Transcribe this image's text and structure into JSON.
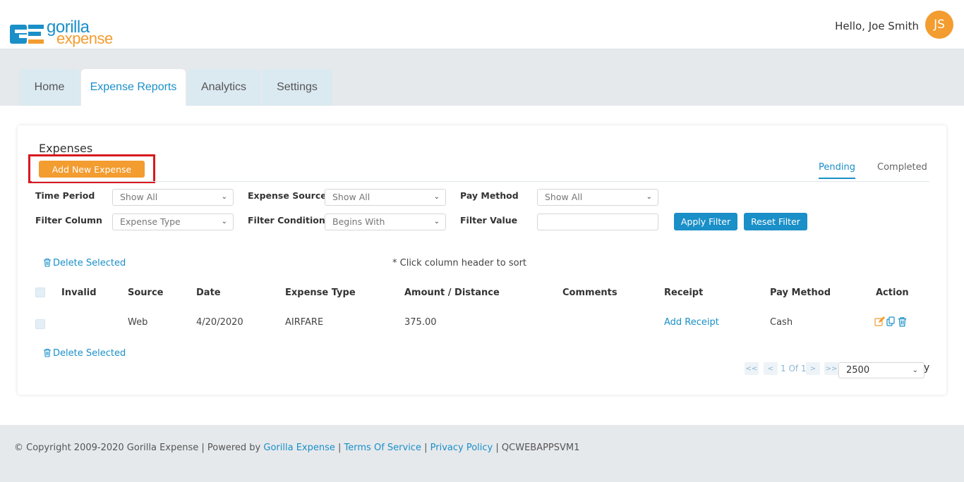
{
  "header": {
    "logo_word1": "gorilla",
    "logo_word2": "expense",
    "greeting": "Hello, Joe Smith",
    "avatar_initials": "JS"
  },
  "nav_tabs": [
    {
      "label": "Home",
      "active": false
    },
    {
      "label": "Expense Reports",
      "active": true
    },
    {
      "label": "Analytics",
      "active": false
    },
    {
      "label": "Settings",
      "active": false
    }
  ],
  "expenses": {
    "title": "Expenses",
    "add_button": "Add New Expense",
    "status_tabs": {
      "pending": "Pending",
      "completed": "Completed"
    }
  },
  "filters": {
    "time_period": {
      "label": "Time Period",
      "value": "Show All"
    },
    "expense_source": {
      "label": "Expense Source",
      "value": "Show All"
    },
    "pay_method": {
      "label": "Pay Method",
      "value": "Show All"
    },
    "filter_column": {
      "label": "Filter Column",
      "value": "Expense Type"
    },
    "filter_condition": {
      "label": "Filter Condition",
      "value": "Begins With"
    },
    "filter_value": {
      "label": "Filter Value",
      "value": ""
    },
    "apply_button": "Apply Filter",
    "reset_button": "Reset Filter"
  },
  "table": {
    "delete_selected": "Delete Selected",
    "sort_note": "* Click column header to sort",
    "columns": [
      "Invalid",
      "Source",
      "Date",
      "Expense Type",
      "Amount / Distance",
      "Comments",
      "Receipt",
      "Pay Method",
      "Action"
    ],
    "rows": [
      {
        "invalid": "",
        "source": "Web",
        "date": "4/20/2020",
        "expense_type": "AIRFARE",
        "amount": "375.00",
        "comments": "",
        "receipt": "Add Receipt",
        "pay_method": "Cash"
      }
    ]
  },
  "pagination": {
    "first": "<<",
    "prev": "<",
    "page_text": "1 Of 1",
    "next": ">",
    "last": ">>",
    "page_size": "2500",
    "trailing_char": "y"
  },
  "footer": {
    "copyright": "Copyright 2009-2020 Gorilla Expense | Powered by",
    "powered_link": "Gorilla Expense",
    "sep1": "|",
    "terms": "Terms Of Service",
    "sep2": "|",
    "privacy": "Privacy Policy",
    "sep3": "|",
    "server": "QCWEBAPPSVM1"
  },
  "colors": {
    "brand_blue": "#1a8fc8",
    "brand_orange": "#f39c2f",
    "highlight_red": "#d71920"
  },
  "icons": [
    "copyright-icon",
    "trash-icon",
    "edit-icon",
    "copy-icon",
    "chevron-down-icon"
  ]
}
